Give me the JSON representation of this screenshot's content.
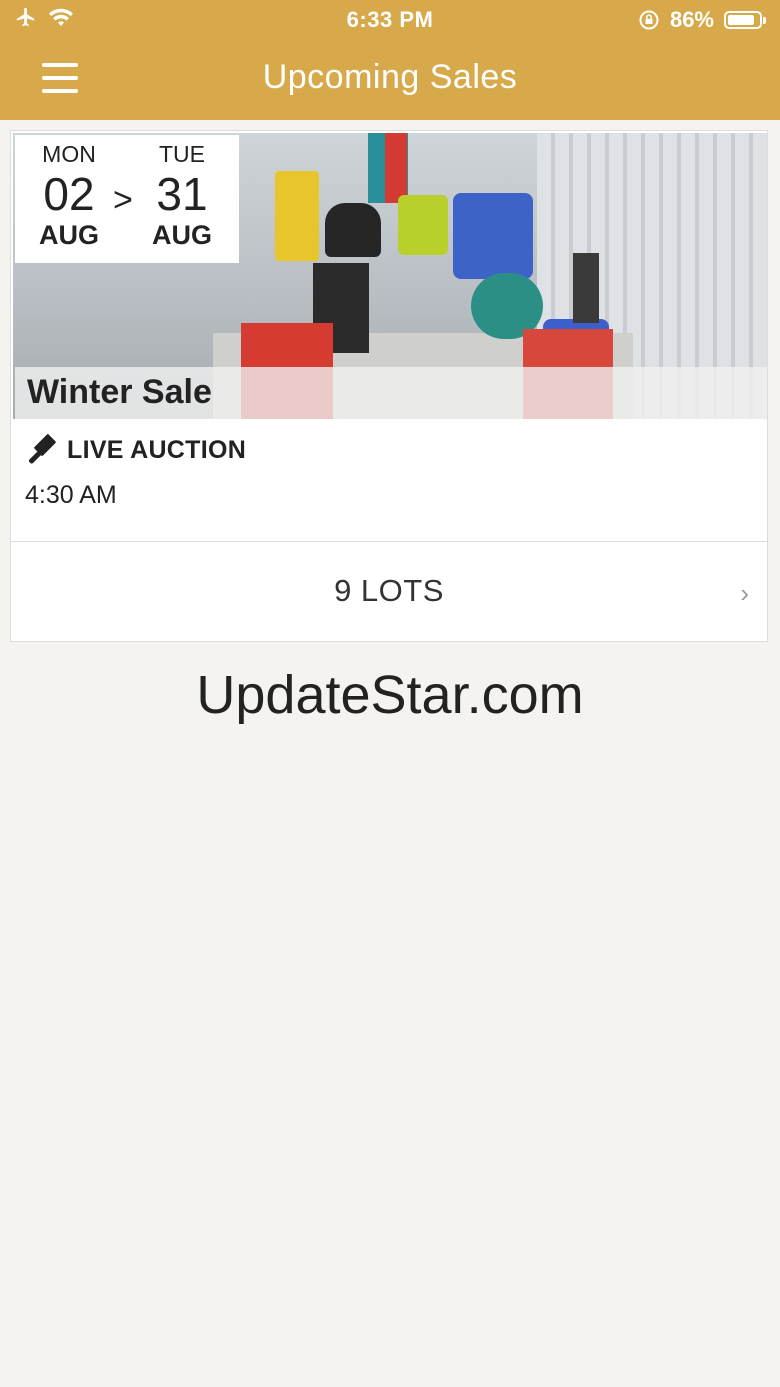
{
  "status_bar": {
    "time": "6:33 PM",
    "battery": "86%",
    "battery_level": 0.86
  },
  "header": {
    "title": "Upcoming Sales",
    "menu_icon": "hamburger-menu-icon"
  },
  "sale": {
    "start": {
      "weekday": "MON",
      "day": "02",
      "month": "AUG"
    },
    "separator": ">",
    "end": {
      "weekday": "TUE",
      "day": "31",
      "month": "AUG"
    },
    "name": "Winter Sale",
    "type_label": "LIVE AUCTION",
    "type_icon": "gavel-icon",
    "time": "4:30 AM",
    "lots_label": "9 LOTS"
  },
  "footer": {
    "watermark": "UpdateStar.com"
  },
  "colors": {
    "header": "#d8a94a",
    "background": "#f4f3ef"
  }
}
